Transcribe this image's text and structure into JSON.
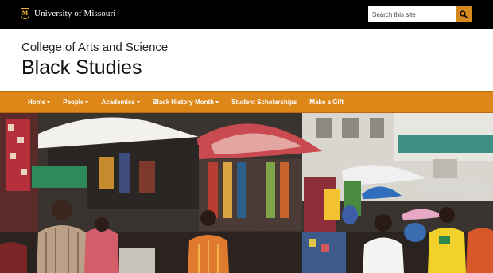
{
  "topbar": {
    "brand_name": "University of Missouri",
    "brand_mark": "M",
    "brand_color": "#F1B82D",
    "search_placeholder": "Search this site",
    "search_icon": "search-icon"
  },
  "header": {
    "college": "College of Arts and Science",
    "department": "Black Studies"
  },
  "nav": {
    "accent": "#DD8718",
    "items": [
      {
        "label": "Home",
        "dropdown": true
      },
      {
        "label": "People",
        "dropdown": true
      },
      {
        "label": "Academics",
        "dropdown": true
      },
      {
        "label": "Black History Month",
        "dropdown": true
      },
      {
        "label": "Student Scholarships",
        "dropdown": false
      },
      {
        "label": "Make a Gift",
        "dropdown": false
      }
    ]
  },
  "hero": {
    "subject": "outdoor street market with umbrellas and shoppers"
  }
}
